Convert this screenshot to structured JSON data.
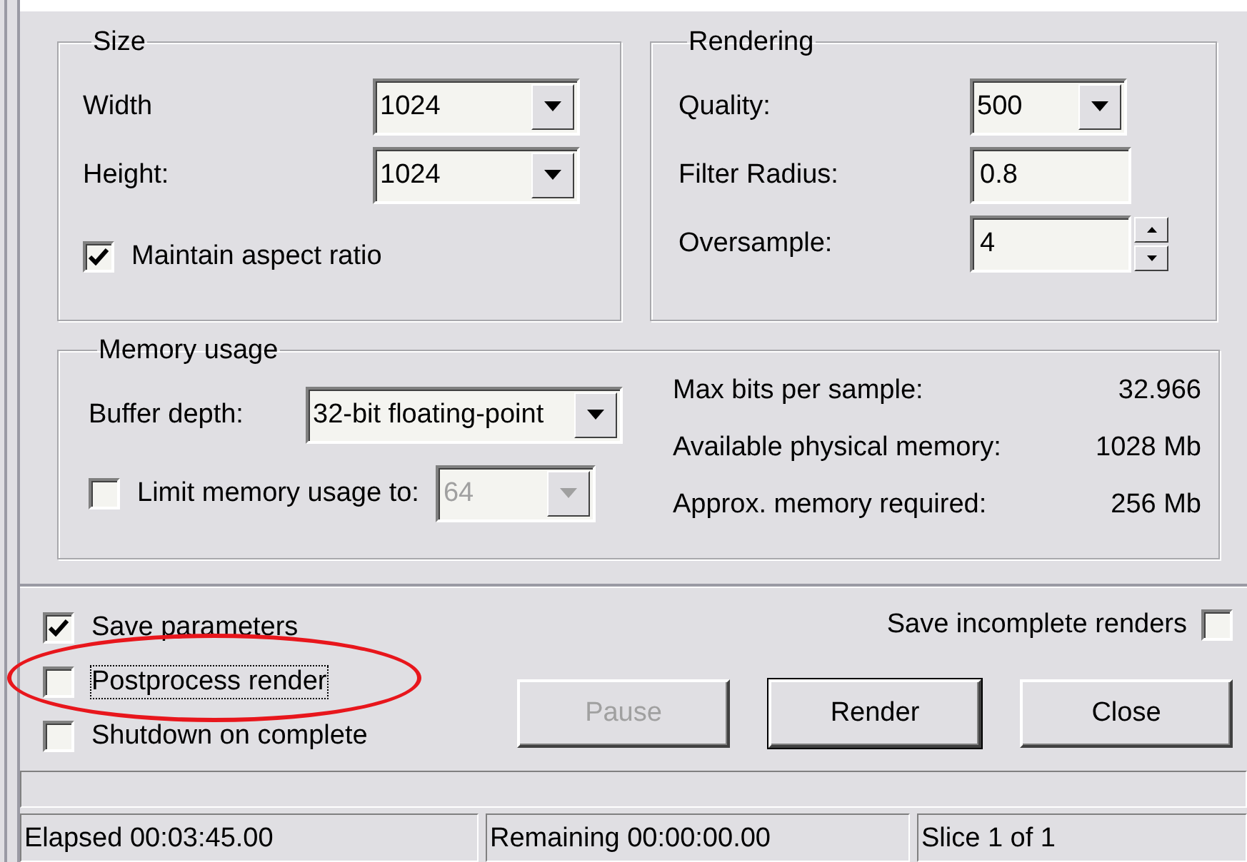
{
  "size_group": {
    "title": "Size",
    "width": {
      "label": "Width",
      "value": "1024"
    },
    "height": {
      "label": "Height:",
      "value": "1024"
    },
    "maintain_aspect": {
      "label": "Maintain aspect ratio",
      "checked": true
    }
  },
  "rendering_group": {
    "title": "Rendering",
    "quality": {
      "label": "Quality:",
      "value": "500"
    },
    "filter_radius": {
      "label": "Filter Radius:",
      "value": "0.8"
    },
    "oversample": {
      "label": "Oversample:",
      "value": "4"
    }
  },
  "memory_group": {
    "title": "Memory usage",
    "buffer_depth": {
      "label": "Buffer depth:",
      "value": "32-bit floating-point"
    },
    "limit": {
      "label": "Limit memory usage to:",
      "checked": false,
      "value": "64",
      "disabled": true
    },
    "stats": [
      {
        "label": "Max bits per sample:",
        "value": "32.966"
      },
      {
        "label": "Available physical memory:",
        "value": "1028 Mb"
      },
      {
        "label": "Approx. memory required:",
        "value": "256 Mb"
      }
    ]
  },
  "options": [
    {
      "label": "Save parameters",
      "checked": true,
      "focused": false,
      "circled": false
    },
    {
      "label": "Postprocess render",
      "checked": false,
      "focused": true,
      "circled": true
    },
    {
      "label": "Shutdown on complete",
      "checked": false,
      "focused": false,
      "circled": false
    }
  ],
  "save_incomplete": {
    "label": "Save incomplete renders",
    "checked": false
  },
  "buttons": [
    {
      "label": "Pause",
      "disabled": true,
      "default": false
    },
    {
      "label": "Render",
      "disabled": false,
      "default": true
    },
    {
      "label": "Close",
      "disabled": false,
      "default": false
    }
  ],
  "status_bar": [
    "Elapsed 00:03:45.00",
    "Remaining 00:00:00.00",
    "Slice 1 of 1"
  ]
}
